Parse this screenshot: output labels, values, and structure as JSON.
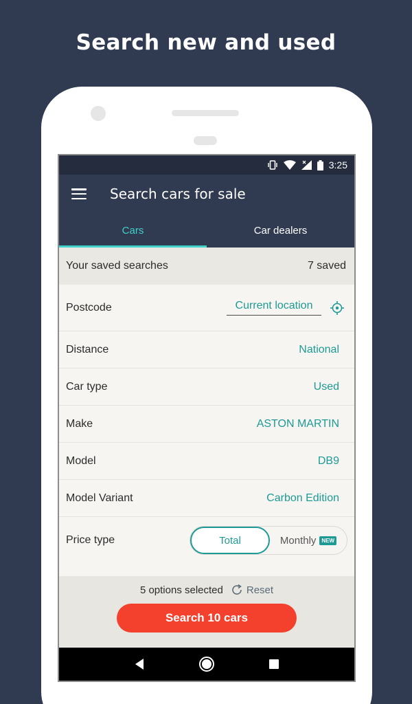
{
  "headline": "Search new and used",
  "status": {
    "time": "3:25"
  },
  "appbar": {
    "title": "Search cars for sale"
  },
  "tabs": [
    {
      "label": "Cars",
      "active": true
    },
    {
      "label": "Car dealers",
      "active": false
    }
  ],
  "saved": {
    "label": "Your saved searches",
    "count": "7 saved"
  },
  "fields": {
    "postcode": {
      "label": "Postcode",
      "value": "Current location"
    },
    "distance": {
      "label": "Distance",
      "value": "National"
    },
    "car_type": {
      "label": "Car type",
      "value": "Used"
    },
    "make": {
      "label": "Make",
      "value": "ASTON MARTIN"
    },
    "model": {
      "label": "Model",
      "value": "DB9"
    },
    "variant": {
      "label": "Model Variant",
      "value": "Carbon Edition"
    },
    "price_type": {
      "label": "Price type",
      "options": [
        "Total",
        "Monthly"
      ],
      "selected": "Total",
      "badge": "NEW"
    }
  },
  "footer": {
    "options_selected": "5 options selected",
    "reset_label": "Reset",
    "search_label": "Search 10 cars"
  },
  "colors": {
    "accent": "#1e9a95",
    "tab_accent": "#3fd2cb",
    "primary_button": "#f4412e",
    "header": "#303a51"
  }
}
